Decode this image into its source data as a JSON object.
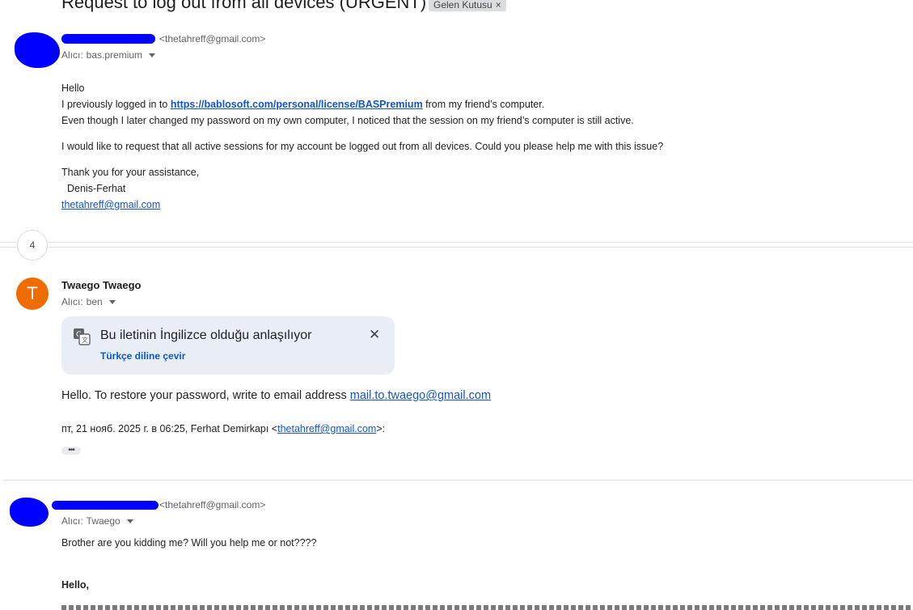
{
  "thread": {
    "subject": "Request to log out from all devices (URGENT)",
    "label": "Gelen Kutusu",
    "label_close": "×",
    "collapsed_count": "4"
  },
  "message1": {
    "sender_email": "<thetahreff@gmail.com>",
    "to_label": "Alıcı:",
    "to_value": "bas.premium",
    "greeting": "Hello",
    "line1_pre": "I previously logged in to ",
    "line1_link": "https://bablosoft.com/personal/license/BASPremium",
    "line1_post": " from my friend’s computer.",
    "line2": "Even though I later changed my password on my own computer, I noticed that the session on my friend’s computer is still active.",
    "line3": "I would like to request that all active sessions for my account be logged out from all devices. Could you please help me with this issue?",
    "thanks": "Thank you for your assistance,",
    "signature_name": "Denis-Ferhat",
    "signature_email": "thetahreff@gmail.com"
  },
  "message2": {
    "avatar_letter": "T",
    "sender_name": "Twaego Twaego",
    "to_label": "Alıcı:",
    "to_value": "ben",
    "translate_title": "Bu iletinin İngilizce olduğu anlaşılıyor",
    "translate_action": "Türkçe diline çevir",
    "translate_close": "✕",
    "body_pre": "Hello. To restore your password, write to email address ",
    "body_link": "mail.to.twaego@gmail.com",
    "quote_pre": "пт, 21 нояб. 2025 г. в 06:25, Ferhat Demirkapı <",
    "quote_link": "thetahreff@gmail.com",
    "quote_post": ">:",
    "ellipsis": "•••"
  },
  "message3": {
    "sender_email": "<thetahreff@gmail.com>",
    "to_label": "Alıcı:",
    "to_value": "Twaego",
    "line1": "Brother are you kidding me? Will you help me or not????",
    "line2": "Hello,"
  },
  "colors": {
    "avatar_orange": "#ef6c00",
    "link_blue": "#1155cc",
    "translate_bg": "#e9eef6",
    "redaction_blue": "#0000ff"
  }
}
